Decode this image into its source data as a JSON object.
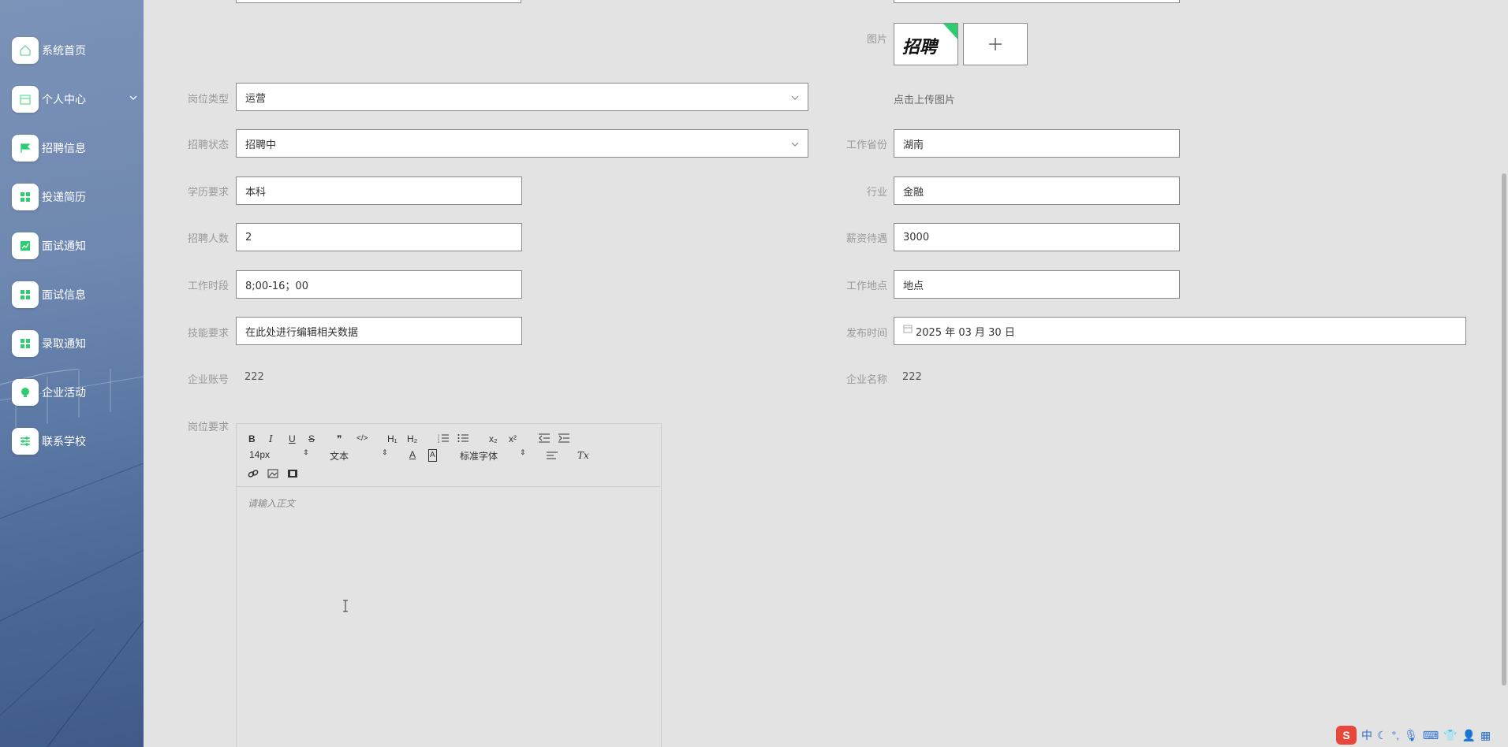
{
  "sidebar": {
    "items": [
      {
        "label": "系统首页",
        "icon": "home-icon"
      },
      {
        "label": "个人中心",
        "icon": "calendar-icon",
        "has_arrow": true
      },
      {
        "label": "招聘信息",
        "icon": "flag-icon"
      },
      {
        "label": "投递简历",
        "icon": "grid-icon"
      },
      {
        "label": "面试通知",
        "icon": "chart-icon"
      },
      {
        "label": "面试信息",
        "icon": "grid-icon"
      },
      {
        "label": "录取通知",
        "icon": "grid-icon"
      },
      {
        "label": "企业活动",
        "icon": "bulb-icon"
      },
      {
        "label": "联系学校",
        "icon": "sliders-icon"
      }
    ],
    "accent": "#2ecc71"
  },
  "form": {
    "image_label": "图片",
    "upload_hint": "点击上传图片",
    "thumb_text": "招聘",
    "job_type": {
      "label": "岗位类型",
      "value": "运营"
    },
    "status": {
      "label": "招聘状态",
      "value": "招聘中"
    },
    "province": {
      "label": "工作省份",
      "value": "湖南"
    },
    "education": {
      "label": "学历要求",
      "value": "本科"
    },
    "industry": {
      "label": "行业",
      "value": "金融"
    },
    "headcount": {
      "label": "招聘人数",
      "value": "2"
    },
    "salary": {
      "label": "薪资待遇",
      "value": "3000"
    },
    "hours": {
      "label": "工作时段",
      "value": "8;00-16；00"
    },
    "location": {
      "label": "工作地点",
      "value": "地点"
    },
    "skills": {
      "label": "技能要求",
      "value": "在此处进行编辑相关数据"
    },
    "publish_time": {
      "label": "发布时间",
      "value": "2025 年 03 月 30 日"
    },
    "company_account": {
      "label": "企业账号",
      "value": "222"
    },
    "company_name": {
      "label": "企业名称",
      "value": "222"
    },
    "requirements": {
      "label": "岗位要求"
    }
  },
  "editor": {
    "bold": "B",
    "italic": "I",
    "underline": "U",
    "strike": "S",
    "quote": "❞",
    "code": "</>",
    "h1": "H₁",
    "h2": "H₂",
    "sub": "x₂",
    "sup": "x²",
    "size_select": "14px",
    "format_select": "文本",
    "font_select": "标准字体",
    "clear": "Tx",
    "placeholder": "请输入正文"
  },
  "tray": {
    "ime": "中"
  }
}
